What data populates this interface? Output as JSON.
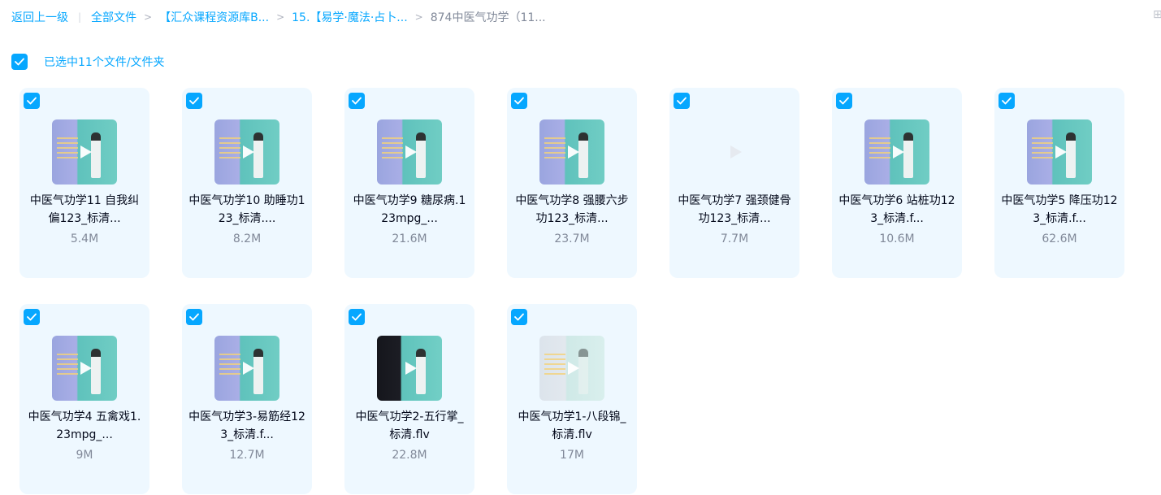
{
  "breadcrumb": {
    "back": "返回上一级",
    "items": [
      {
        "label": "全部文件"
      },
      {
        "label": "【汇众课程资源库B..."
      },
      {
        "label": "15.【易学·魔法·占卜..."
      },
      {
        "label": "874中医气功学（11..."
      }
    ]
  },
  "selection": {
    "label": "已选中11个文件/文件夹"
  },
  "files": [
    {
      "name": "中医气功学11 自我纠偏123_标清...",
      "size": "5.4M",
      "thumb": "video"
    },
    {
      "name": "中医气功学10 助睡功123_标清....",
      "size": "8.2M",
      "thumb": "video"
    },
    {
      "name": "中医气功学9 糖尿病.123mpg_...",
      "size": "21.6M",
      "thumb": "video"
    },
    {
      "name": "中医气功学8 强腰六步功123_标清...",
      "size": "23.7M",
      "thumb": "video"
    },
    {
      "name": "中医气功学7 强颈健骨功123_标清...",
      "size": "7.7M",
      "thumb": "blank"
    },
    {
      "name": "中医气功学6 站桩功123_标清.f...",
      "size": "10.6M",
      "thumb": "video"
    },
    {
      "name": "中医气功学5 降压功123_标清.f...",
      "size": "62.6M",
      "thumb": "video"
    },
    {
      "name": "中医气功学4 五禽戏1.23mpg_...",
      "size": "9M",
      "thumb": "video"
    },
    {
      "name": "中医气功学3-易筋经123_标清.f...",
      "size": "12.7M",
      "thumb": "video"
    },
    {
      "name": "中医气功学2-五行掌_标清.flv",
      "size": "22.8M",
      "thumb": "dark"
    },
    {
      "name": "中医气功学1-八段锦_标清.flv",
      "size": "17M",
      "thumb": "pale"
    }
  ],
  "colors": {
    "accent": "#06a7ff",
    "card_bg": "#eef8ff",
    "secondary_text": "#818999"
  }
}
